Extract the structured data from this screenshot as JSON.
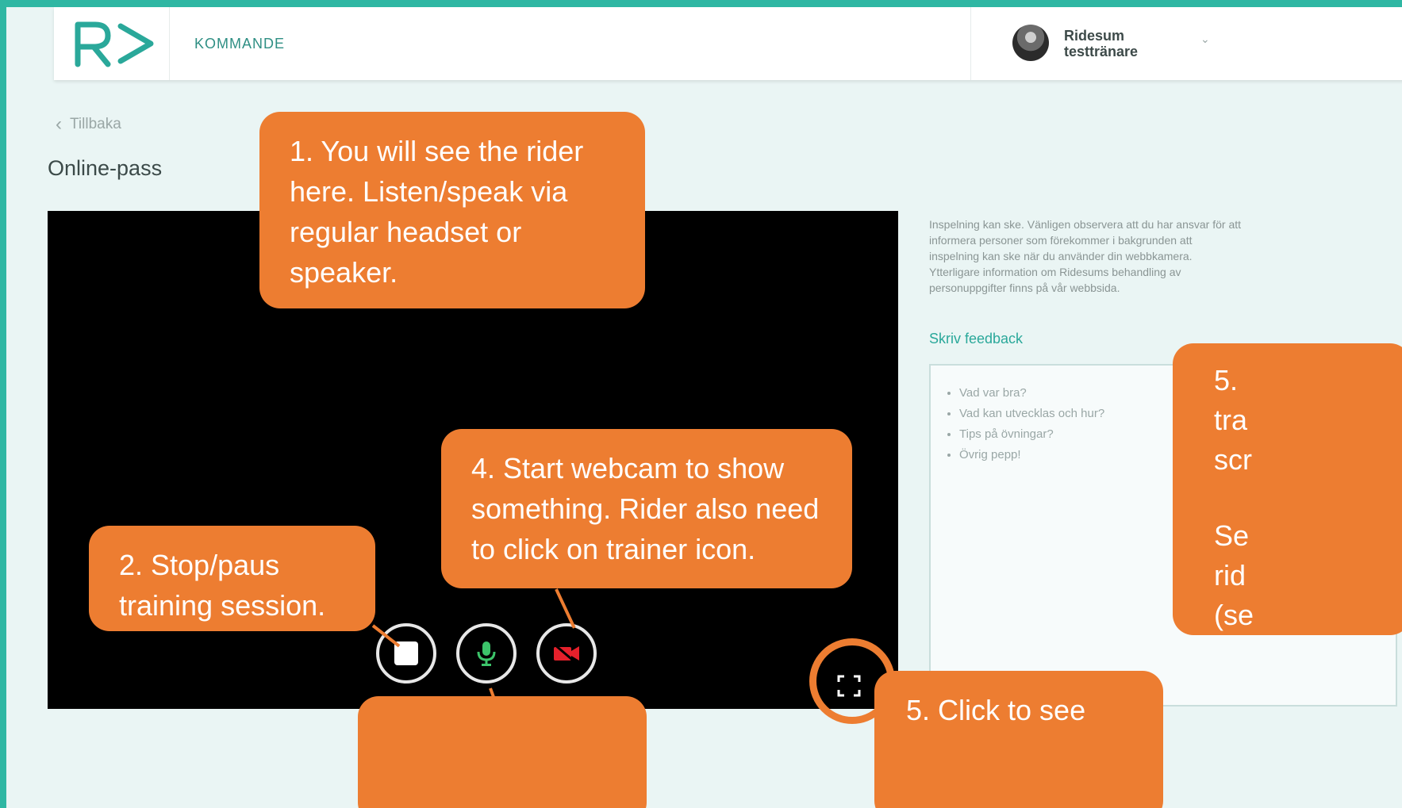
{
  "header": {
    "logo_text": "RD",
    "nav_item": "KOMMANDE",
    "user_name_line1": "Ridesum",
    "user_name_line2": "testtränare",
    "caret": "⌄"
  },
  "back_label": "Tillbaka",
  "page_title": "Online-pass",
  "info_text": "Inspelning kan ske. Vänligen observera att du har ansvar för att informera personer som förekommer i bakgrunden att inspelning kan ske när du använder din webbkamera. Ytterligare information om Ridesums behandling av personuppgifter finns på vår webbsida.",
  "feedback": {
    "label": "Skriv feedback",
    "placeholder_items": [
      "Vad var bra?",
      "Vad kan utvecklas och hur?",
      "Tips på övningar?",
      "Övrig pepp!"
    ]
  },
  "callouts": {
    "c1": "1. You will see the rider here. Listen/speak via regular headset or speaker.",
    "c2": "2. Stop/paus training session.",
    "c4": "4. Start webcam to show something. Rider also need to click on trainer icon.",
    "c5a": "5. Click to see",
    "c5b_line1": "5.",
    "c5b_line2": "tra",
    "c5b_line3": "scr",
    "c5b_line4": "Se",
    "c5b_line5": "rid",
    "c5b_line6": "(se"
  },
  "colors": {
    "frame": "#2fb7a3",
    "background": "#eaf5f4",
    "accent": "#2aa89a",
    "callout": "#ed7d31",
    "video": "#000000",
    "mic_icon": "#3cc46a",
    "camera_off_icon": "#e5202b"
  },
  "icons": {
    "stop": "stop-icon",
    "mic": "microphone-icon",
    "camera": "camera-off-icon",
    "fullscreen": "fullscreen-icon",
    "back": "chevron-left-icon",
    "dropdown": "chevron-down-icon"
  }
}
